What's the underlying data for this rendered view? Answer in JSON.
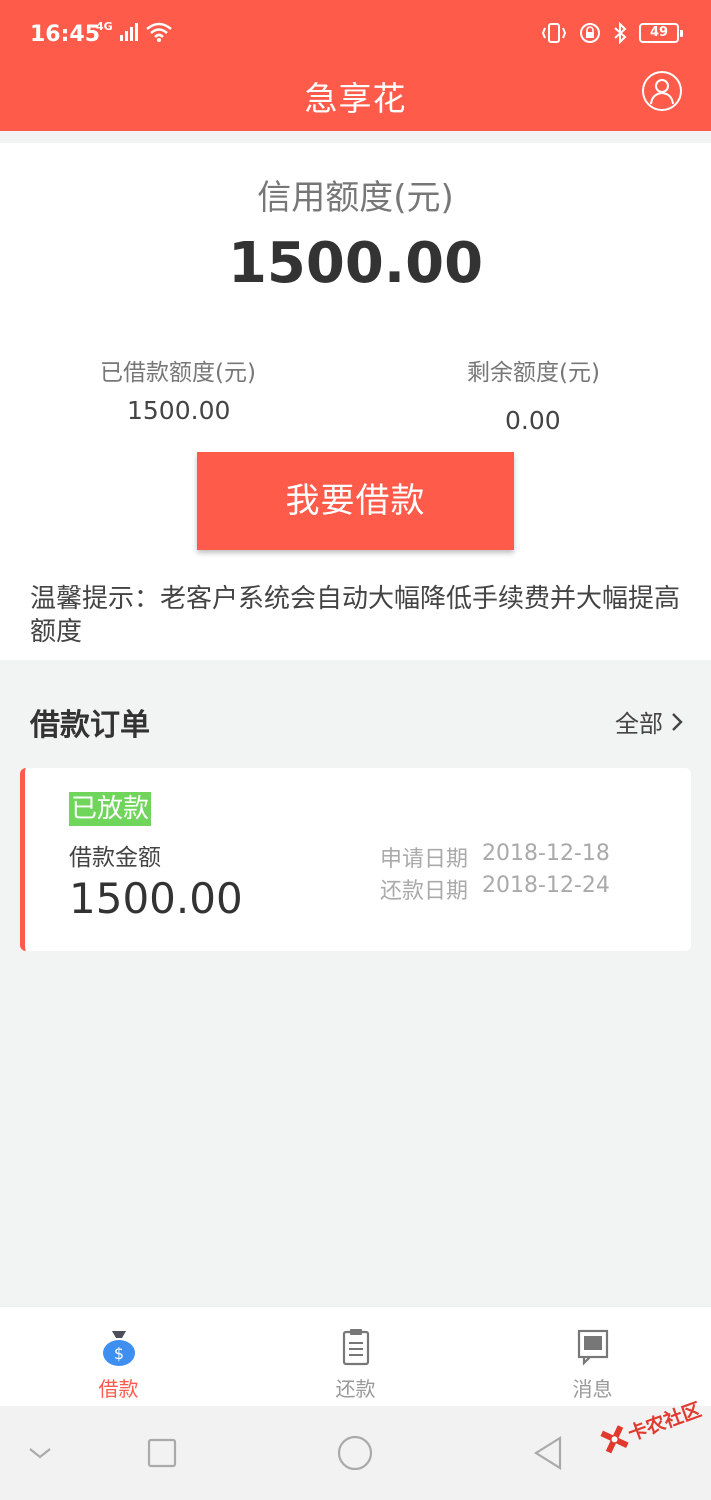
{
  "status_bar": {
    "time": "16:45",
    "network": "4G",
    "battery": "49"
  },
  "header": {
    "title": "急享花"
  },
  "credit": {
    "label": "信用额度(元)",
    "amount": "1500.00",
    "used_label": "已借款额度(元)",
    "used_value": "1500.00",
    "remaining_label": "剩余额度(元)",
    "remaining_value": "0.00",
    "borrow_button": "我要借款",
    "tip": "温馨提示：老客户系统会自动大幅降低手续费并大幅提高额度"
  },
  "orders": {
    "title": "借款订单",
    "all_label": "全部",
    "items": [
      {
        "status": "已放款",
        "amount_label": "借款金额",
        "amount": "1500.00",
        "apply_label": "申请日期",
        "apply_date": "2018-12-18",
        "repay_label": "还款日期",
        "repay_date": "2018-12-24"
      }
    ]
  },
  "tabs": [
    {
      "label": "借款",
      "icon": "money-bag-icon",
      "active": true
    },
    {
      "label": "还款",
      "icon": "clipboard-icon",
      "active": false
    },
    {
      "label": "消息",
      "icon": "message-icon",
      "active": false
    }
  ],
  "watermark": {
    "text": "卡农社区"
  },
  "colors": {
    "accent": "#ff5b4a",
    "status_green": "#6fd55b",
    "background": "#f2f3f3"
  }
}
